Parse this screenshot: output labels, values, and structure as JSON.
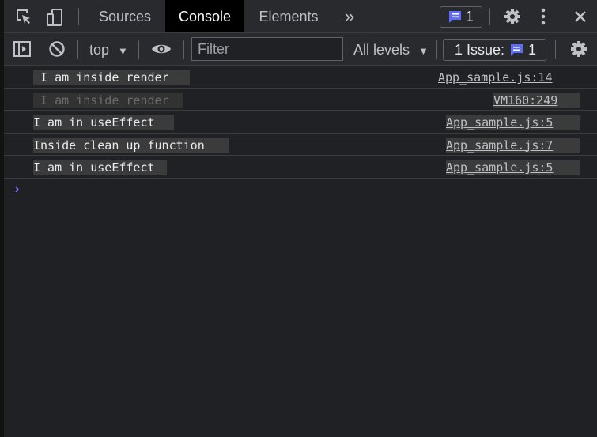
{
  "tabs": {
    "sources": "Sources",
    "console": "Console",
    "elements": "Elements",
    "more": "»",
    "messages_count": "1"
  },
  "toolbar": {
    "context": "top",
    "context_arrow": "▼",
    "filter_placeholder": "Filter",
    "levels": "All levels",
    "levels_arrow": "▼",
    "issues_label": "1 Issue:",
    "issues_count": "1"
  },
  "console": {
    "rows": [
      {
        "message": " I am inside render",
        "source": "App_sample.js:14"
      },
      {
        "message": " I am inside render",
        "source": "VM160:249"
      },
      {
        "message": "I am in useEffect",
        "source": "App_sample.js:5"
      },
      {
        "message": "Inside clean up function",
        "source": "App_sample.js:7"
      },
      {
        "message": "I am in useEffect",
        "source": "App_sample.js:5"
      }
    ],
    "prompt": "›"
  },
  "colors": {
    "accent": "#5c6ef8",
    "background": "#202124",
    "toolbar": "#292a2d"
  }
}
